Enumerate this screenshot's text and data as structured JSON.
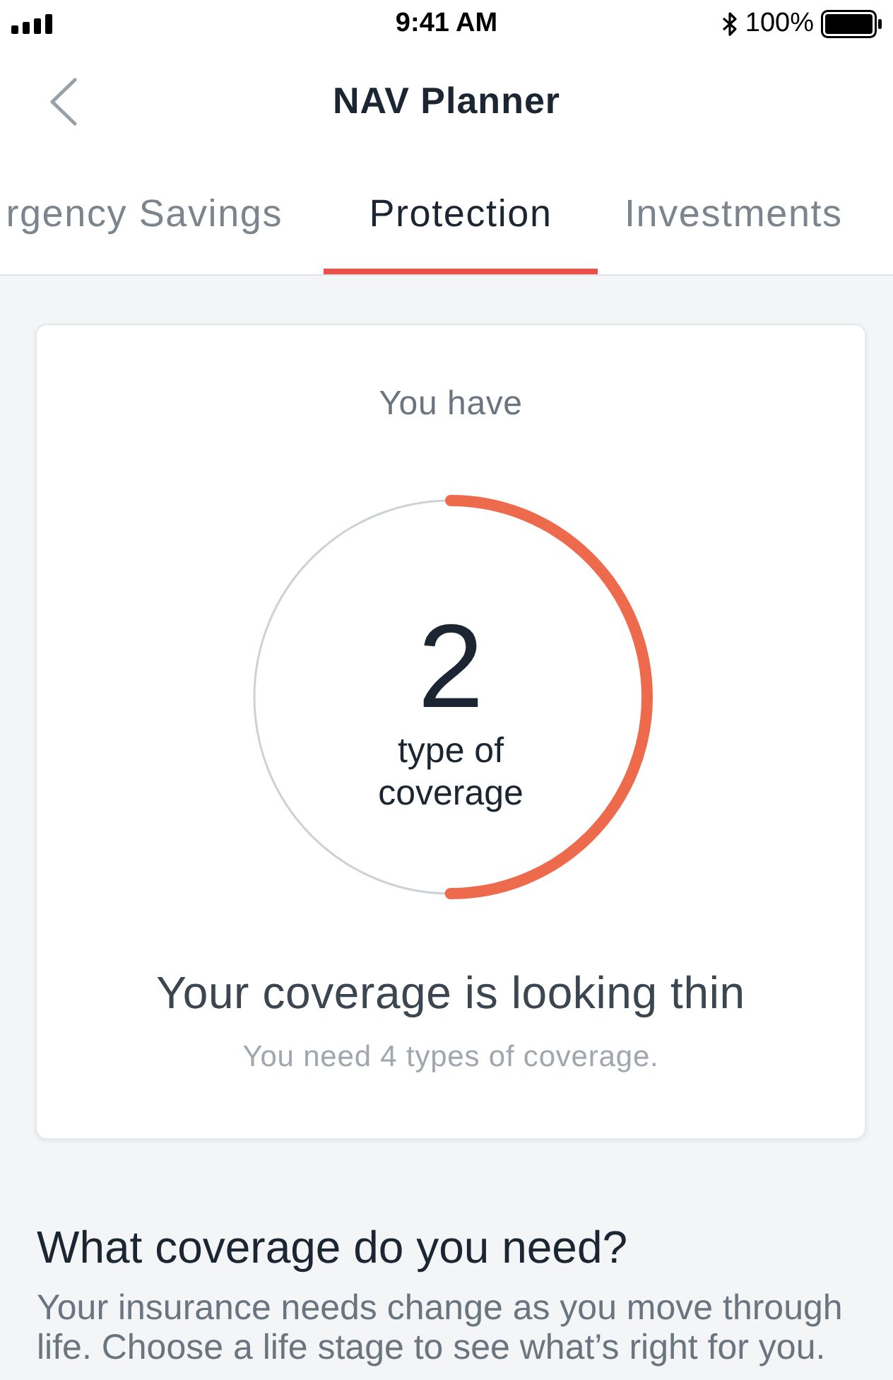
{
  "status_bar": {
    "time": "9:41 AM",
    "battery": "100%"
  },
  "nav": {
    "title": "NAV Planner"
  },
  "tabs": [
    {
      "label": "rgency Savings",
      "selected": false
    },
    {
      "label": "Protection",
      "selected": true
    },
    {
      "label": "Investments",
      "selected": false
    }
  ],
  "coverage_card": {
    "intro": "You have",
    "count": "2",
    "count_label": "type of coverage",
    "level": 0.5,
    "headline": "Your coverage is looking thin",
    "note": "You need 4 types of coverage."
  },
  "section": {
    "heading": "What coverage do you need?",
    "body": "Your insurance needs change as you move through life. Choose a life stage to see what’s right for you."
  }
}
